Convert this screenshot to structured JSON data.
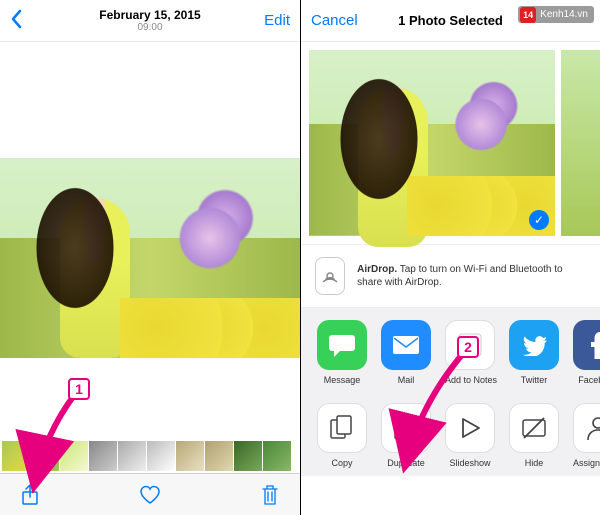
{
  "left": {
    "back_icon": "chevron-left",
    "date": "February 15, 2015",
    "time": "09:00",
    "edit": "Edit",
    "toolbar": {
      "share": "share",
      "favorite": "heart",
      "trash": "trash"
    }
  },
  "right": {
    "cancel": "Cancel",
    "title": "1 Photo Selected",
    "airdrop": {
      "title": "AirDrop.",
      "desc": "Tap to turn on Wi-Fi and Bluetooth to share with AirDrop."
    },
    "share_apps": [
      {
        "label": "Message",
        "color": "#37d15a",
        "icon": "message",
        "name": "message"
      },
      {
        "label": "Mail",
        "color": "#1f8cff",
        "icon": "mail",
        "name": "mail"
      },
      {
        "label": "Add to Notes",
        "color": "#ffffff",
        "icon": "notes",
        "name": "add-to-notes"
      },
      {
        "label": "Twitter",
        "color": "#1da1f2",
        "icon": "twitter",
        "name": "twitter"
      },
      {
        "label": "Facebook",
        "color": "#3b5998",
        "icon": "facebook",
        "name": "facebook"
      }
    ],
    "actions": [
      {
        "label": "Copy",
        "name": "copy"
      },
      {
        "label": "Duplicate",
        "name": "duplicate"
      },
      {
        "label": "Slideshow",
        "name": "slideshow"
      },
      {
        "label": "Hide",
        "name": "hide"
      },
      {
        "label": "Assign to Contact",
        "name": "assign-to-contact"
      }
    ]
  },
  "annotations": {
    "badge1": "1",
    "badge2": "2"
  },
  "watermark": "Kenh14.vn"
}
